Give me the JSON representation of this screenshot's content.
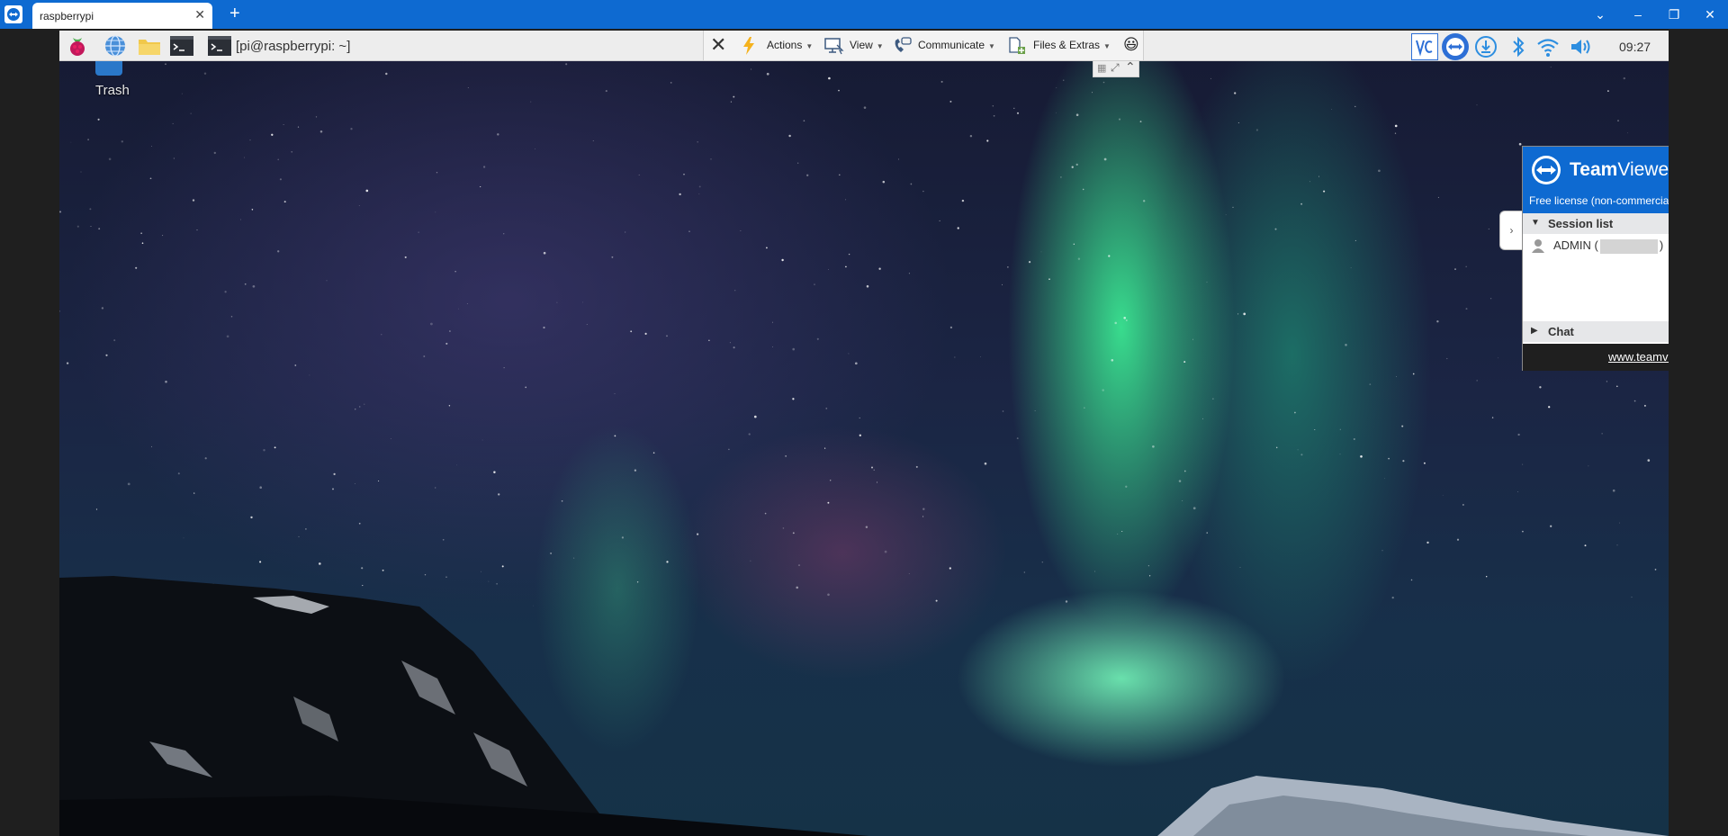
{
  "window": {
    "tab_title": "raspberrypi",
    "tab_close_glyph": "✕",
    "new_tab_glyph": "+",
    "controls": {
      "chevron": "⌄",
      "minimize": "–",
      "restore": "❐",
      "close": "✕"
    }
  },
  "panel": {
    "terminal_title": "[pi@raspberrypi: ~]",
    "clock": "09:27",
    "icons": [
      "raspberry-menu-icon",
      "web-browser-icon",
      "file-manager-icon",
      "terminal-icon",
      "terminal-icon",
      "vnc-icon",
      "teamviewer-icon",
      "download-icon",
      "bluetooth-icon",
      "wifi-icon",
      "volume-icon"
    ]
  },
  "toolbar": {
    "close_glyph": "✕",
    "actions": "Actions",
    "view": "View",
    "communicate": "Communicate",
    "files_extras": "Files & Extras",
    "emoji": "😃"
  },
  "desktop": {
    "trash_label": "Trash"
  },
  "tv_panel": {
    "brand_bold": "Team",
    "brand_rest": "Viewer",
    "close_glyph": "✕",
    "license": "Free license (non-commercial use only)",
    "session_list": "Session list",
    "session_user": "ADMIN (",
    "session_user_end": ")",
    "chat": "Chat",
    "link": "www.teamviewer.com",
    "collapse_glyph": "›"
  },
  "colors": {
    "teamviewer_blue": "#0e6ad1",
    "panel_gray": "#ededed"
  }
}
